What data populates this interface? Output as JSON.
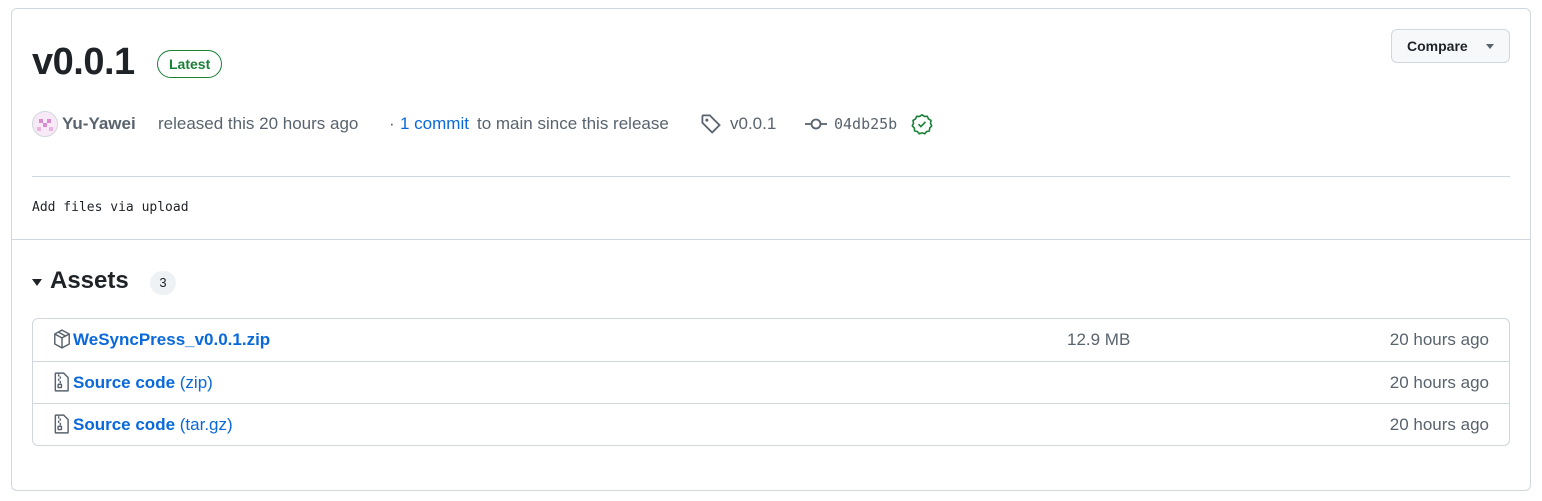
{
  "release": {
    "title": "v0.0.1",
    "badge": "Latest",
    "compare_label": "Compare",
    "author": "Yu-Yawei",
    "released_text": "released this 20 hours ago",
    "commit_sep": "·",
    "commit_link": "1 commit",
    "commit_tail": "to main since this release",
    "tag": "v0.0.1",
    "sha": "04db25b",
    "notes": "Add files via upload"
  },
  "assets": {
    "title": "Assets",
    "count": "3",
    "items": [
      {
        "name": "WeSyncPress_v0.0.1.zip",
        "suffix": "",
        "size": "12.9 MB",
        "time": "20 hours ago",
        "icon": "package-icon"
      },
      {
        "name": "Source code",
        "suffix": " (zip)",
        "size": "",
        "time": "20 hours ago",
        "icon": "file-zip-icon"
      },
      {
        "name": "Source code",
        "suffix": " (tar.gz)",
        "size": "",
        "time": "20 hours ago",
        "icon": "file-zip-icon"
      }
    ]
  },
  "colors": {
    "link": "#0969da",
    "success": "#1a7f37",
    "muted": "#59636e",
    "border": "#d0d7de"
  }
}
